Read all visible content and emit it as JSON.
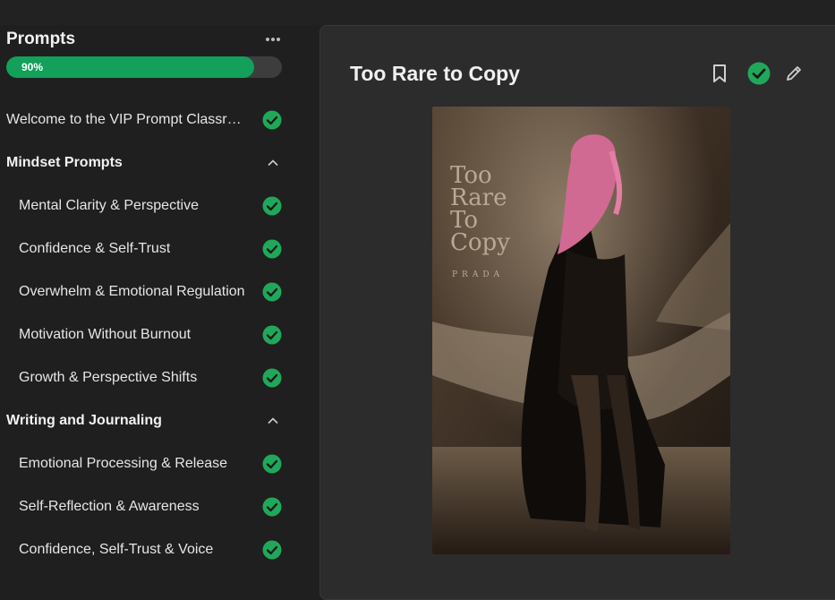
{
  "sidebar": {
    "title": "Prompts",
    "progress": {
      "percent": 90,
      "label": "90%"
    },
    "rows": [
      {
        "kind": "item",
        "top": true,
        "label": "Welcome to the VIP Prompt Classroom",
        "done": true
      },
      {
        "kind": "section",
        "label": "Mindset Prompts",
        "expanded": true
      },
      {
        "kind": "item",
        "label": "Mental Clarity & Perspective",
        "done": true
      },
      {
        "kind": "item",
        "label": "Confidence & Self-Trust",
        "done": true
      },
      {
        "kind": "item",
        "label": "Overwhelm & Emotional Regulation",
        "done": true
      },
      {
        "kind": "item",
        "label": "Motivation Without Burnout",
        "done": true
      },
      {
        "kind": "item",
        "label": "Growth & Perspective Shifts",
        "done": true
      },
      {
        "kind": "section",
        "label": "Writing and Journaling",
        "expanded": true
      },
      {
        "kind": "item",
        "label": "Emotional Processing & Release",
        "done": true
      },
      {
        "kind": "item",
        "label": "Self-Reflection & Awareness",
        "done": true
      },
      {
        "kind": "item",
        "label": "Confidence, Self-Trust & Voice",
        "done": true
      }
    ]
  },
  "main": {
    "title": "Too Rare to Copy",
    "image": {
      "overlay_title": [
        "Too",
        "Rare",
        "To",
        "Copy"
      ],
      "overlay_brand": "PRADA"
    },
    "body_text": ""
  },
  "colors": {
    "accent_green": "#12a05a",
    "check_green": "#1fa85a",
    "panel": "#2c2c2c",
    "background": "#1f1f1f"
  }
}
